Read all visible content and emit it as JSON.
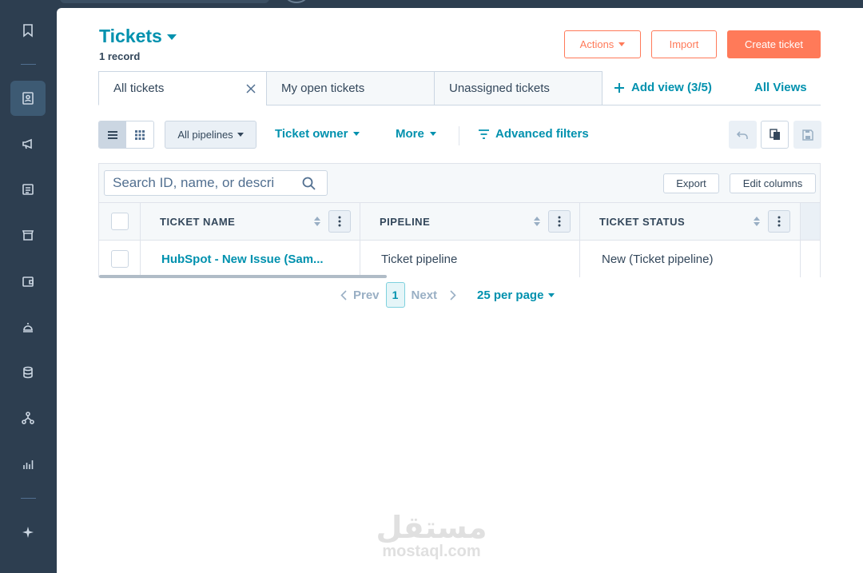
{
  "header": {
    "title": "Tickets",
    "record_count": "1 record",
    "actions_label": "Actions",
    "import_label": "Import",
    "create_label": "Create ticket"
  },
  "tabs": [
    {
      "label": "All tickets"
    },
    {
      "label": "My open tickets"
    },
    {
      "label": "Unassigned tickets"
    }
  ],
  "views": {
    "add_view_label": "Add view (3/5)",
    "all_views_label": "All Views"
  },
  "toolbar": {
    "pipelines_label": "All pipelines",
    "owner_label": "Ticket owner",
    "more_label": "More",
    "advanced_filters_label": "Advanced filters"
  },
  "table": {
    "search_placeholder": "Search ID, name, or descri",
    "export_label": "Export",
    "edit_columns_label": "Edit columns",
    "columns": [
      "TICKET NAME",
      "PIPELINE",
      "TICKET STATUS"
    ],
    "rows": [
      {
        "name": "HubSpot - New Issue (Sam...",
        "pipeline": "Ticket pipeline",
        "status": "New (Ticket pipeline)"
      }
    ]
  },
  "pagination": {
    "prev_label": "Prev",
    "current_page": "1",
    "next_label": "Next",
    "per_page_label": "25 per page"
  },
  "watermark": {
    "arabic": "مستقل",
    "latin": "mostaql.com"
  },
  "colors": {
    "accent": "#0091ae",
    "cta": "#ff7a59",
    "sidebar": "#2d3e50"
  }
}
